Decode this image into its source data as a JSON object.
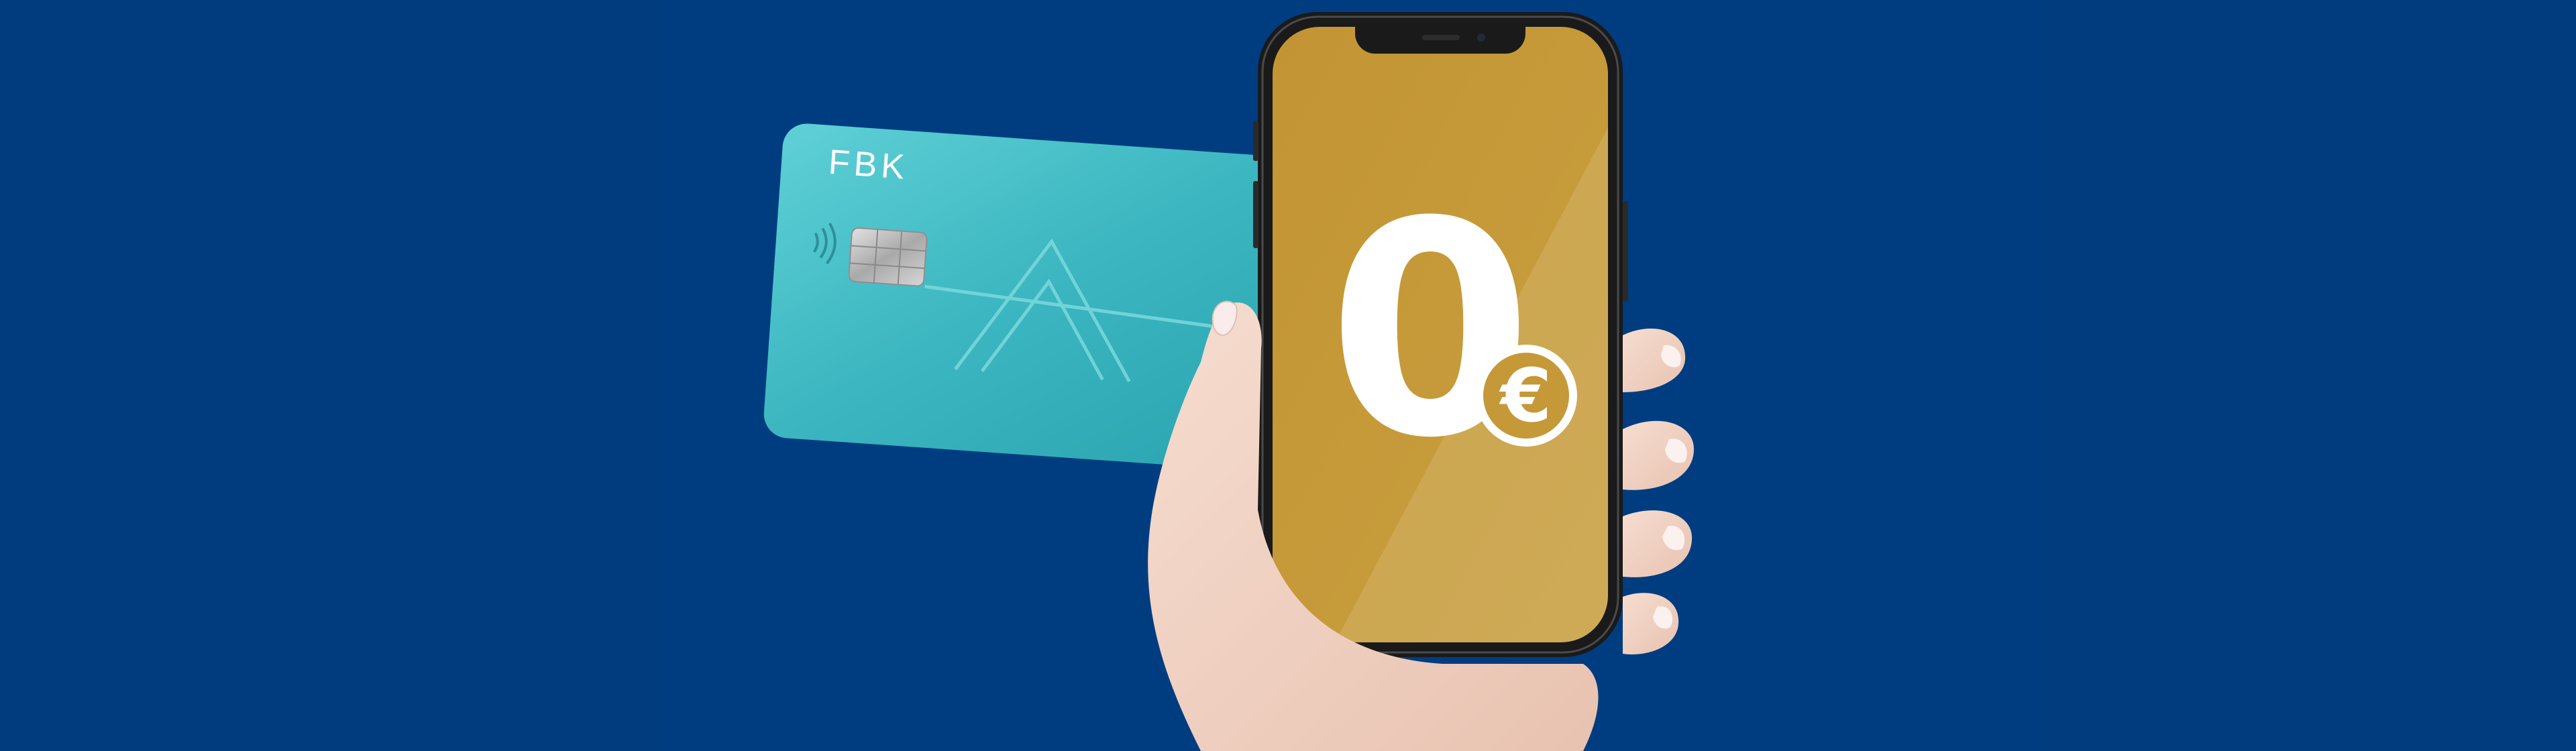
{
  "card": {
    "brand": "FBK"
  },
  "phone": {
    "price_value": "0",
    "price_currency": "€"
  },
  "colors": {
    "background": "#003c7e",
    "card": "#3fb9c2",
    "screen": "#c49a3a",
    "price_text": "#ffffff"
  },
  "icons": {
    "contactless": "contactless-icon",
    "chip": "chip-icon",
    "card_logo": "chevron-up-logo-icon"
  }
}
